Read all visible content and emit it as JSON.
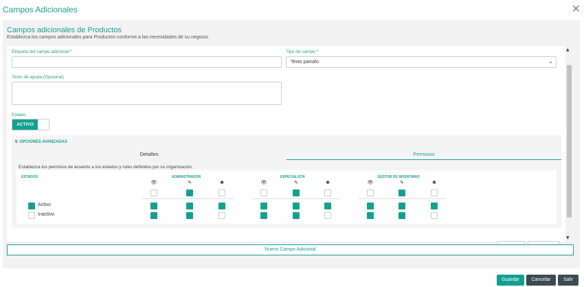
{
  "modal": {
    "title": "Campos Adicionales"
  },
  "header": {
    "title": "Campos adicionales de Productos",
    "subtitle": "Establezca los campos adicionales para Productos conforme a las necesidades de su negocio."
  },
  "form": {
    "label_field_label": "Etiqueta del campo adicional *",
    "label_field_value": "",
    "type_label": "Tipo de campo *",
    "type_value": "Texto párrafo",
    "help_label": "Texto de ayuda (Opcional)",
    "help_value": "",
    "status_label": "Estado",
    "status_toggle": "ACTIVO"
  },
  "advanced": {
    "heading": "OPCIONES AVANZADAS",
    "tabs": [
      {
        "label": "Detalles",
        "active": false
      },
      {
        "label": "Permisos",
        "active": true
      }
    ],
    "description": "Establezca los permisos de acuerdo a los estados y roles definidos por su organización.",
    "table": {
      "states_header": "ESTADOS",
      "roles": [
        {
          "name": "ADMINISTRADOR"
        },
        {
          "name": "ESPECIALISTA"
        },
        {
          "name": "GESTOR DE INVENTARIO"
        }
      ],
      "permission_icons": [
        "eye-icon",
        "edit-icon",
        "asterisk-icon"
      ],
      "header_checks": [
        [
          false,
          true,
          false
        ],
        [
          false,
          true,
          false
        ],
        [
          false,
          true,
          false
        ]
      ],
      "rows": [
        {
          "state": "Activo",
          "state_checked": true,
          "checks": [
            [
              true,
              true,
              true
            ],
            [
              true,
              true,
              true
            ],
            [
              true,
              true,
              true
            ]
          ]
        },
        {
          "state": "Inactivo",
          "state_checked": false,
          "checks": [
            [
              true,
              true,
              false
            ],
            [
              true,
              true,
              false
            ],
            [
              true,
              true,
              false
            ]
          ]
        }
      ]
    }
  },
  "actions": {
    "new_field": "Nuevo Campo Adicional",
    "save": "Guardar",
    "cancel": "Cancelar",
    "exit": "Salir"
  },
  "colors": {
    "accent": "#13a090",
    "dark_button": "#3d4a52"
  }
}
